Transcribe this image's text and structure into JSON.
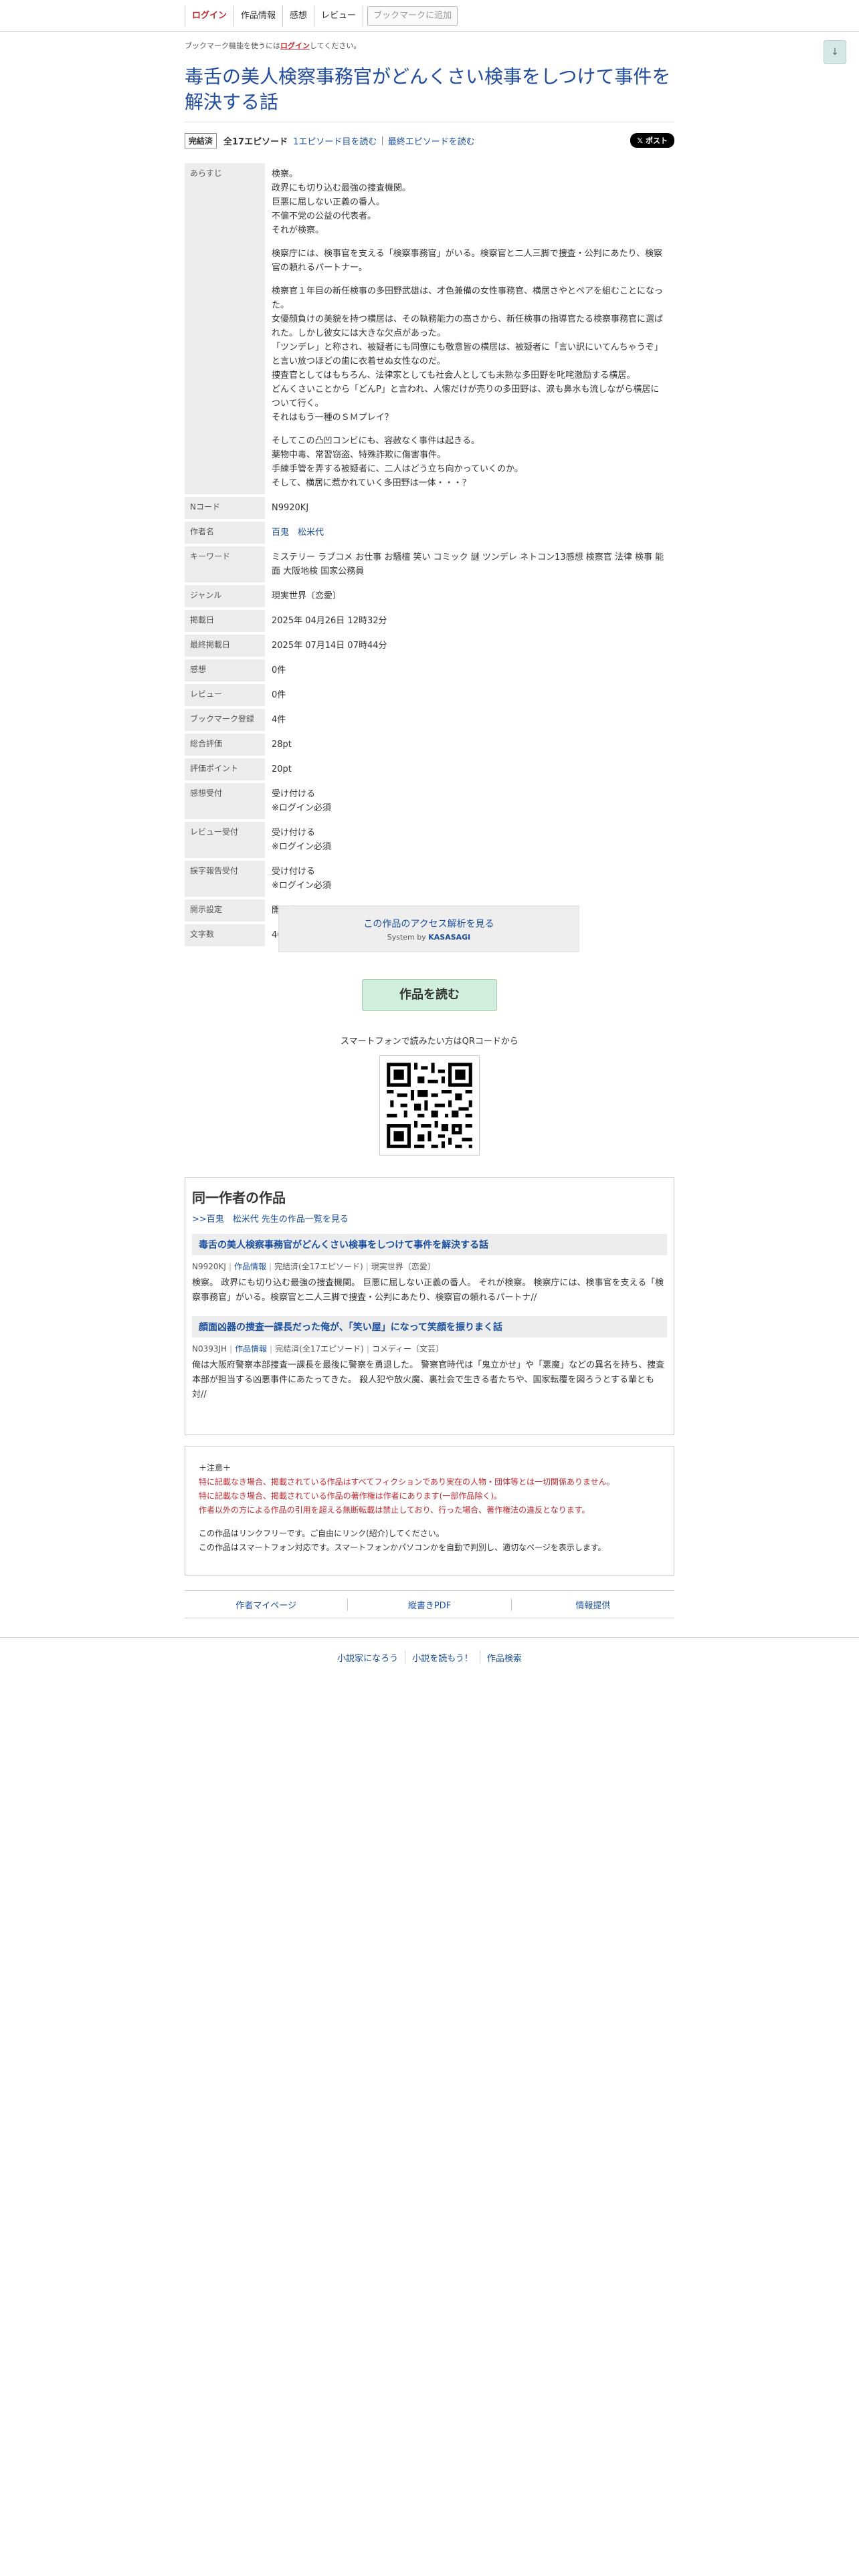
{
  "topbar": {
    "login": "ログイン",
    "work_info": "作品情報",
    "impression": "感想",
    "review": "レビュー",
    "bookmark": "ブックマークに追加"
  },
  "scroll_button": "↓",
  "notice": {
    "prefix": "ブックマーク機能を使うには",
    "link": "ログイン",
    "suffix": "してください。"
  },
  "title": "毒舌の美人検察事務官がどんくさい検事をしつけて事件を解決する話",
  "meta": {
    "status": "完結済",
    "episodes": "全17エピソード",
    "first_episode": "1エピソード目を読む",
    "separator": "|",
    "last_episode": "最終エピソードを読む",
    "x_post": "𝕏 ポスト"
  },
  "info": {
    "synopsis_label": "あらすじ",
    "synopsis": [
      "検察。\n政界にも切り込む最強の捜査機関。\n巨悪に屈しない正義の番人。\n不偏不党の公益の代表者。\nそれが検察。",
      "検察庁には、検事官を支える「検察事務官」がいる。検察官と二人三脚で捜査・公判にあたり、検察官の頼れるパートナー。",
      "検察官１年目の新任検事の多田野武雄は、才色兼備の女性事務官、横居さやとペアを組むことになった。\n女優顔負けの美貌を持つ横居は、その執務能力の高さから、新任検事の指導官たる検察事務官に選ばれた。しかし彼女には大きな欠点があった。\n「ツンデレ」と称され、被疑者にも同僚にも敬意皆の横居は、被疑者に「言い訳にいてんちゃうぞ」と言い放つほどの歯に衣着せぬ女性なのだ。\n捜査官としてはもちろん、法律家としても社会人としても未熟な多田野を叱咤激励する横居。\nどんくさいことから「どんP」と言われ、人懐だけが売りの多田野は、涙も鼻水も流しながら横居について行く。\nそれはもう一種のＳＭプレイ？",
      "そしてこの凸凹コンビにも、容赦なく事件は起きる。\n薬物中毒、常習窃盗、特殊詐欺に傷害事件。\n手練手管を弄する被疑者に、二人はどう立ち向かっていくのか。\nそして、横居に惹かれていく多田野は一体・・・？"
    ],
    "rows": [
      {
        "label": "Nコード",
        "value": "N9920KJ"
      },
      {
        "label": "作者名",
        "value": "百鬼　松米代",
        "link": true
      },
      {
        "label": "キーワード",
        "value": "ミステリー ラブコメ お仕事 お騒檀 笑い コミック 謎 ツンデレ ネトコン13感想 検察官 法律 検事 能面 大阪地検 国家公務員"
      },
      {
        "label": "ジャンル",
        "value": "現実世界〔恋愛〕"
      },
      {
        "label": "掲載日",
        "value": "2025年 04月26日 12時32分"
      },
      {
        "label": "最終掲載日",
        "value": "2025年 07月14日 07時44分"
      },
      {
        "label": "感想",
        "value": "0件"
      },
      {
        "label": "レビュー",
        "value": "0件"
      },
      {
        "label": "ブックマーク登録",
        "value": "4件"
      },
      {
        "label": "総合評価",
        "value": "28pt"
      },
      {
        "label": "評価ポイント",
        "value": "20pt"
      },
      {
        "label": "感想受付",
        "value": "受け付ける\n※ログイン必須"
      },
      {
        "label": "レビュー受付",
        "value": "受け付ける\n※ログイン必須"
      },
      {
        "label": "誤字報告受付",
        "value": "受け付ける\n※ログイン必須"
      },
      {
        "label": "開示設定",
        "value": "開示中"
      },
      {
        "label": "文字数",
        "value": "46,328文字"
      }
    ]
  },
  "kasasagi": {
    "link": "この作品のアクセス解析を見る",
    "system_prefix": "System by ",
    "system_name": "KASASAGI"
  },
  "read_button": "作品を読む",
  "qr_label": "スマートフォンで読みたい方はQRコードから",
  "same_author": {
    "heading": "同一作者の作品",
    "all_link": ">>百鬼　松米代 先生の作品一覧を見る",
    "works": [
      {
        "title": "毒舌の美人検察事務官がどんくさい検事をしつけて事件を解決する話",
        "ncode": "N9920KJ",
        "info_link": "作品情報",
        "status": "完結済(全17エピソード)",
        "genre": "現実世界〔恋愛〕",
        "desc": "検察。 政界にも切り込む最強の捜査機関。 巨悪に屈しない正義の番人。 それが検察。 検察庁には、検事官を支える「検察事務官」がいる。検察官と二人三脚で捜査・公判にあたり、検察官の頼れるパートナ//"
      },
      {
        "title": "顔面凶器の捜査一課長だった俺が、「笑い屋」になって笑顔を振りまく話",
        "ncode": "N0393JH",
        "info_link": "作品情報",
        "status": "完結済(全17エピソード)",
        "genre": "コメディー〔文芸〕",
        "desc": "俺は大阪府警察本部捜査一課長を最後に警察を勇退した。 警察官時代は「鬼立かせ」や「悪魔」などの異名を持ち、捜査本部が担当する凶悪事件にあたってきた。 殺人犯や放火魔、裏社会で生きる者たちや、国家転覆を図ろうとする輩とも対//"
      }
    ]
  },
  "notes": {
    "head": "＋注意＋",
    "red_lines": [
      "特に記載なき場合、掲載されている作品はすべてフィクションであり実在の人物・団体等とは一切関係ありません。",
      "特に記載なき場合、掲載されている作品の著作権は作者にあります(一部作品除く)。",
      "作者以外の方による作品の引用を超える無断転載は禁止しており、行った場合、著作権法の違反となります。"
    ],
    "lines": [
      "この作品はリンクフリーです。ご自由にリンク(紹介)してください。",
      "この作品はスマートフォン対応です。スマートフォンかパソコンかを自動で判別し、適切なページを表示します。"
    ]
  },
  "footer_links": [
    "作者マイページ",
    "縦書きPDF",
    "情報提供"
  ],
  "bottom_links": [
    "小説家になろう",
    "小説を読もう！",
    "作品検索"
  ]
}
